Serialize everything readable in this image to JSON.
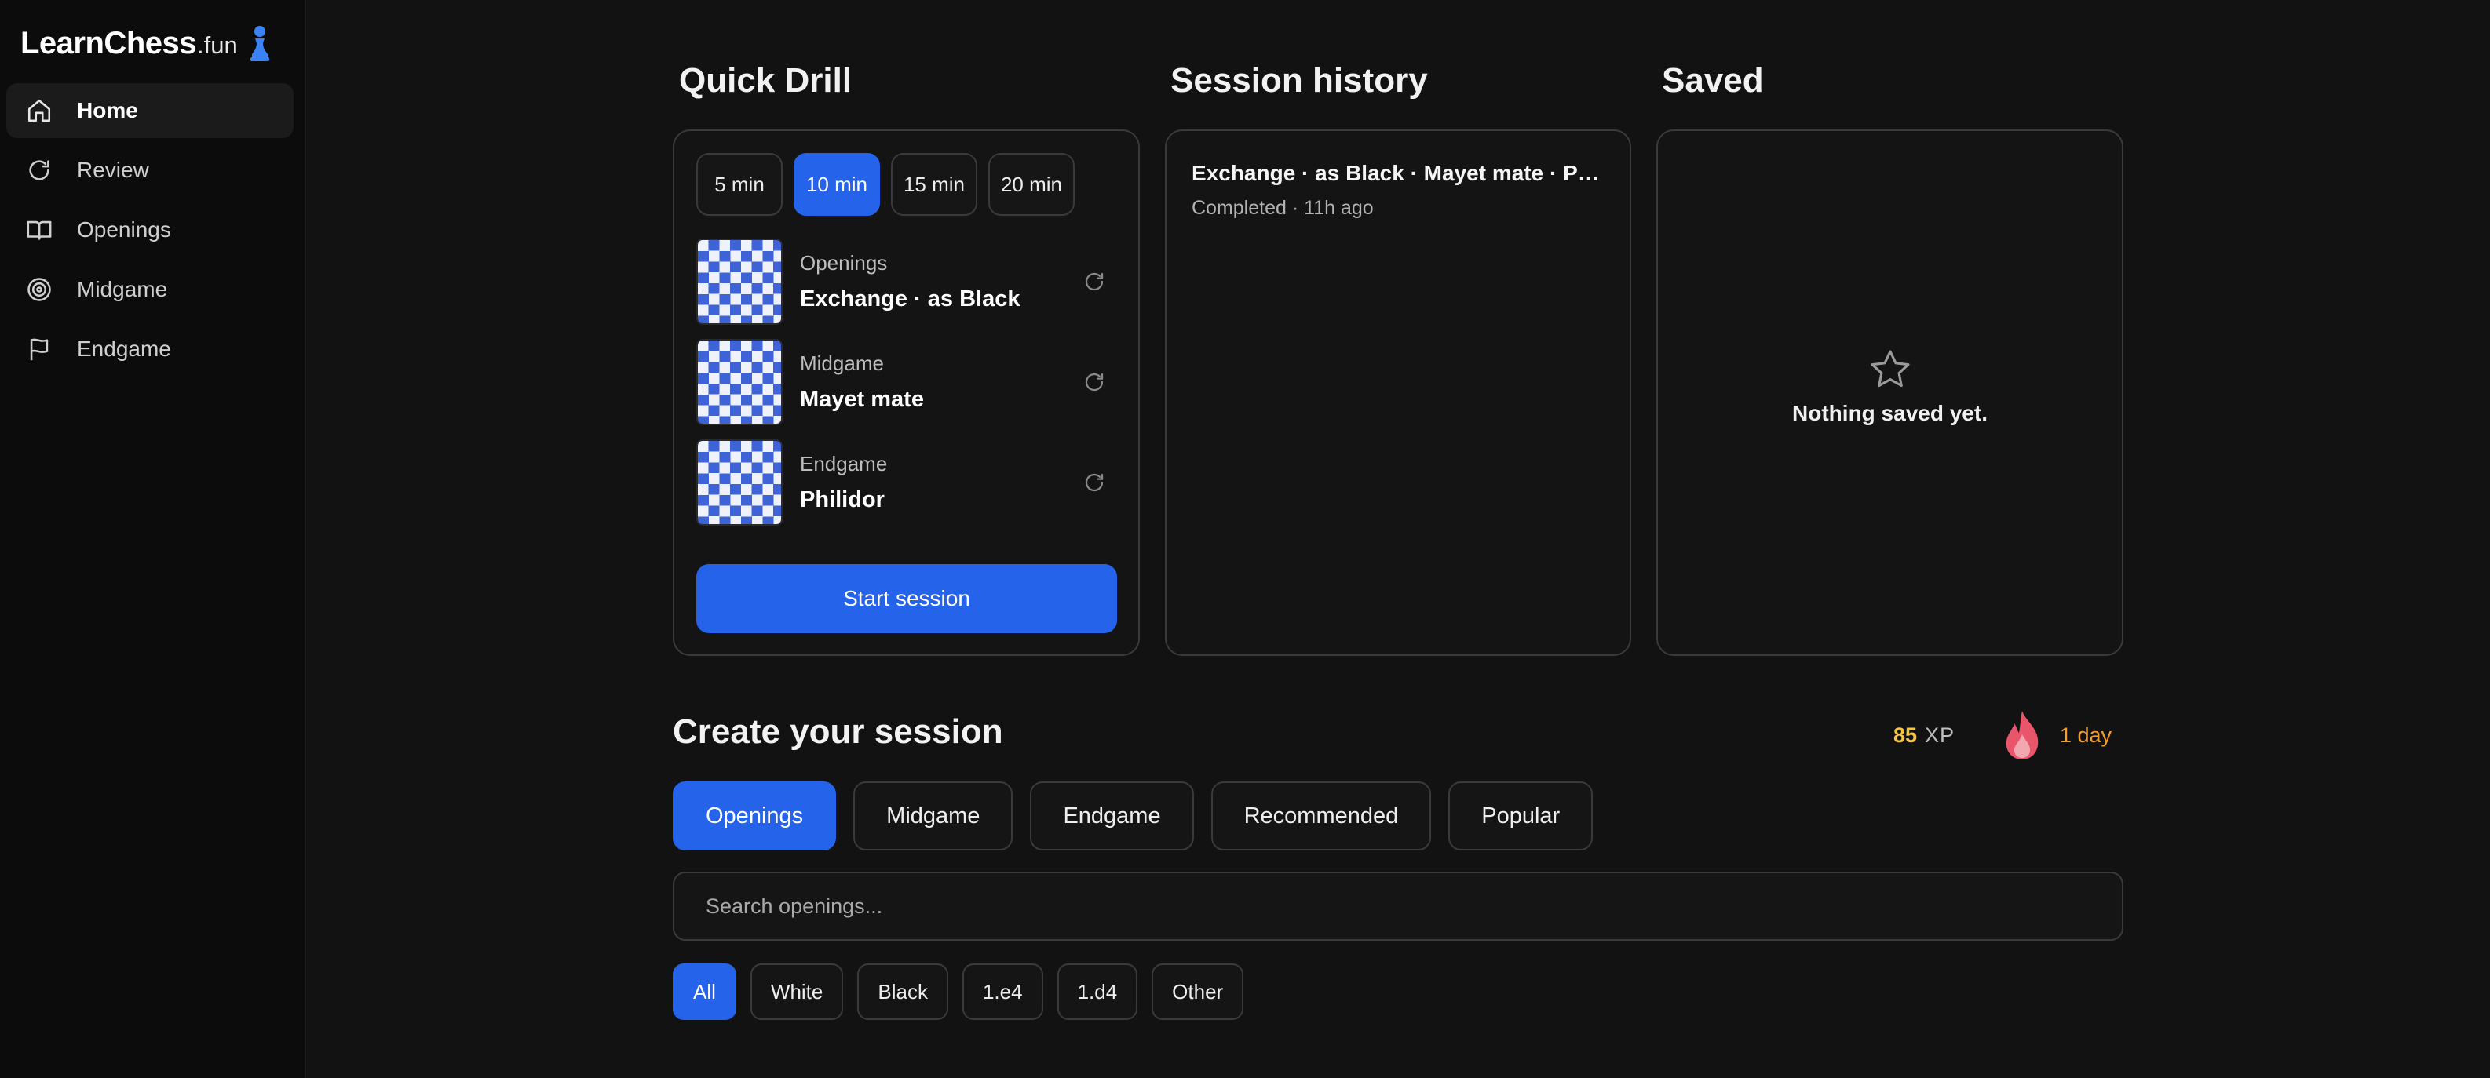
{
  "brand": {
    "name": "LearnChess",
    "tld": ".fun"
  },
  "sidebar": {
    "items": [
      {
        "label": "Home",
        "icon": "home-icon",
        "active": true
      },
      {
        "label": "Review",
        "icon": "refresh-icon"
      },
      {
        "label": "Openings",
        "icon": "book-icon"
      },
      {
        "label": "Midgame",
        "icon": "target-icon"
      },
      {
        "label": "Endgame",
        "icon": "flag-icon"
      }
    ]
  },
  "quick_drill": {
    "title": "Quick Drill",
    "durations": [
      "5 min",
      "10 min",
      "15 min",
      "20 min"
    ],
    "selected_duration": "10 min",
    "drills": [
      {
        "category": "Openings",
        "name": "Exchange · as Black"
      },
      {
        "category": "Midgame",
        "name": "Mayet mate"
      },
      {
        "category": "Endgame",
        "name": "Philidor"
      }
    ],
    "start_label": "Start session"
  },
  "history": {
    "title": "Session history",
    "items": [
      {
        "title": "Exchange · as Black · Mayet mate · Philidor",
        "status": "Completed",
        "time": "11h ago"
      }
    ]
  },
  "saved": {
    "title": "Saved",
    "empty_text": "Nothing saved yet."
  },
  "create": {
    "title": "Create your session",
    "xp": {
      "value": "85",
      "unit": "XP"
    },
    "streak": "1 day",
    "tabs": [
      "Openings",
      "Midgame",
      "Endgame",
      "Recommended",
      "Popular"
    ],
    "active_tab": "Openings",
    "search_placeholder": "Search openings...",
    "filters": [
      "All",
      "White",
      "Black",
      "1.e4",
      "1.d4",
      "Other"
    ],
    "active_filter": "All"
  },
  "colors": {
    "accent": "#2563eb",
    "background": "#121212",
    "sidebar": "#0c0c0c",
    "xp": "#f5c542",
    "streak": "#f59e2b"
  }
}
